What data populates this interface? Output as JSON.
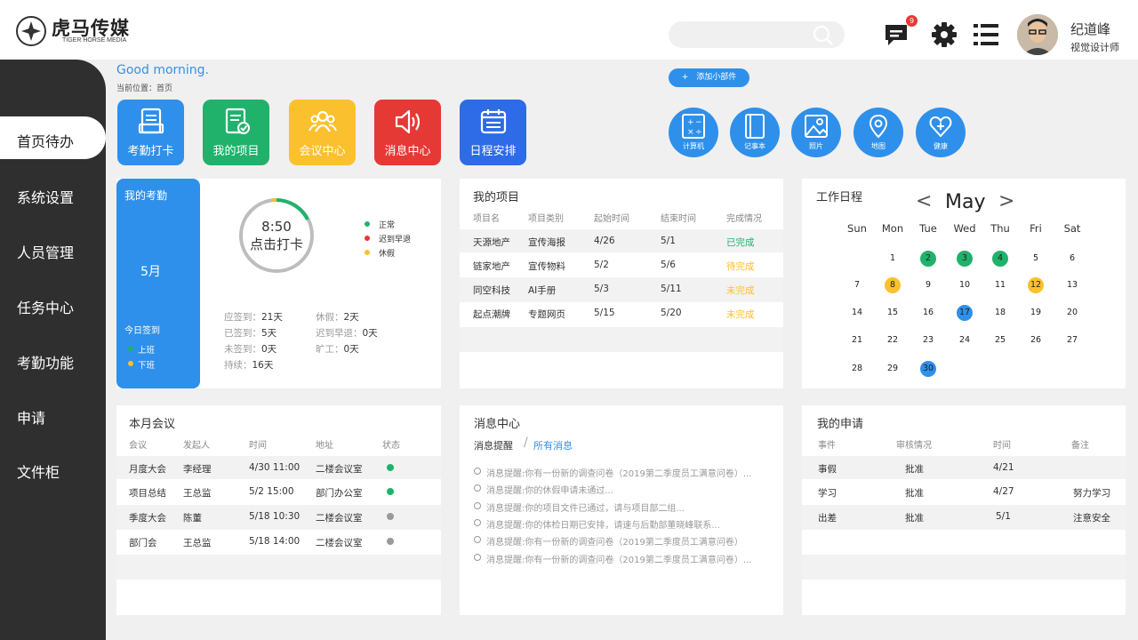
{
  "brand": {
    "name_cn": "虎马传媒",
    "name_en": "TIGER HORSE MEDIA"
  },
  "header": {
    "search_placeholder": "",
    "message_count": "9",
    "user": {
      "name": "纪道峰",
      "role": "视觉设计师"
    }
  },
  "sidebar": {
    "items": [
      "首页待办",
      "系统设置",
      "人员管理",
      "任务中心",
      "考勤功能",
      "申请",
      "文件柜"
    ],
    "active_index": 0
  },
  "greeting": "Good morning.",
  "breadcrumb": "当前位置：首页",
  "add_widget": "+　添加小部件",
  "quick_tiles": [
    {
      "label": "考勤打卡",
      "color": "#2e90ea",
      "icon": "document-icon"
    },
    {
      "label": "我的项目",
      "color": "#20b26b",
      "icon": "checklist-icon"
    },
    {
      "label": "会议中心",
      "color": "#fbc02d",
      "icon": "people-icon"
    },
    {
      "label": "消息中心",
      "color": "#e53935",
      "icon": "speaker-icon"
    },
    {
      "label": "日程安排",
      "color": "#2e6be6",
      "icon": "calendar-icon"
    }
  ],
  "widgets": [
    {
      "label": "计算机",
      "icon": "calculator-icon"
    },
    {
      "label": "记事本",
      "icon": "notebook-icon"
    },
    {
      "label": "照片",
      "icon": "photo-icon"
    },
    {
      "label": "地图",
      "icon": "map-pin-icon"
    },
    {
      "label": "健康",
      "icon": "heart-plus-icon"
    }
  ],
  "attendance": {
    "title": "我的考勤",
    "month": "5月",
    "today_title": "今日签到",
    "shift_on": "上班",
    "shift_off": "下班",
    "clock_time": "8:50",
    "clock_label": "点击打卡",
    "legend": [
      {
        "label": "正常",
        "color": "#20b26b"
      },
      {
        "label": "迟到早退",
        "color": "#e53935"
      },
      {
        "label": "休假",
        "color": "#fbc02d"
      }
    ],
    "stats_left": [
      {
        "label": "应签到：",
        "value": "21天"
      },
      {
        "label": "已签到：",
        "value": "5天"
      },
      {
        "label": "未签到：",
        "value": "0天"
      },
      {
        "label": "持续：",
        "value": "16天"
      }
    ],
    "stats_right": [
      {
        "label": "休假：",
        "value": "2天"
      },
      {
        "label": "迟到早退：",
        "value": "0天"
      },
      {
        "label": "旷工：",
        "value": "0天"
      }
    ]
  },
  "projects": {
    "title": "我的项目",
    "columns": [
      "项目名",
      "项目类别",
      "起始时间",
      "结束时间",
      "完成情况"
    ],
    "rows": [
      {
        "name": "天源地产",
        "type": "宣传海报",
        "start": "4/26",
        "end": "5/1",
        "status": "已完成",
        "status_color": "#20b26b"
      },
      {
        "name": "链家地产",
        "type": "宣传物料",
        "start": "5/2",
        "end": "5/6",
        "status": "待完成",
        "status_color": "#fbc02d"
      },
      {
        "name": "同空科技",
        "type": "AI手册",
        "start": "5/3",
        "end": "5/11",
        "status": "未完成",
        "status_color": "#fbc02d"
      },
      {
        "name": "起点潮牌",
        "type": "专题网页",
        "start": "5/15",
        "end": "5/20",
        "status": "未完成",
        "status_color": "#fbc02d"
      }
    ]
  },
  "schedule": {
    "title": "工作日程",
    "month": "May",
    "weekdays": [
      "Sun",
      "Mon",
      "Tue",
      "Wed",
      "Thu",
      "Fri",
      "Sat"
    ],
    "first_weekday": 1,
    "days_in_month": 30,
    "highlights": {
      "2": "#20b26b",
      "3": "#20b26b",
      "4": "#20b26b",
      "8": "#fbc02d",
      "12": "#fbc02d",
      "17": "#2e90ea",
      "30": "#2e90ea"
    }
  },
  "meetings": {
    "title": "本月会议",
    "columns": [
      "会议",
      "发起人",
      "时间",
      "地址",
      "状态"
    ],
    "rows": [
      {
        "name": "月度大会",
        "host": "李经理",
        "time": "4/30  11:00",
        "place": "二楼会议室",
        "status_color": "#20b26b"
      },
      {
        "name": "项目总结",
        "host": "王总监",
        "time": "5/2  15:00",
        "place": "部门办公室",
        "status_color": "#20b26b"
      },
      {
        "name": "季度大会",
        "host": "陈董",
        "time": "5/18  10:30",
        "place": "二楼会议室",
        "status_color": "#999999"
      },
      {
        "name": "部门会",
        "host": "王总监",
        "time": "5/18  14:00",
        "place": "二楼会议室",
        "status_color": "#999999"
      }
    ]
  },
  "messages": {
    "title": "消息中心",
    "tab_active": "消息提醒",
    "tab_other": "所有消息",
    "items": [
      "消息提醒:你有一份新的调查问卷（2019第二季度员工满意问卷）...",
      "消息提醒:你的休假申请未通过...",
      "消息提醒:你的项目文件已通过，请与项目部二组...",
      "消息提醒:你的体检日期已安排，请速与后勤部董晓峰联系...",
      "消息提醒:你有一份新的调查问卷（2019第二季度员工满意问卷）",
      "消息提醒:你有一份新的调查问卷（2019第二季度员工满意问卷）..."
    ]
  },
  "applications": {
    "title": "我的申请",
    "columns": [
      "事件",
      "审核情况",
      "时间",
      "备注"
    ],
    "rows": [
      {
        "event": "事假",
        "status": "批准",
        "time": "4/21",
        "note": ""
      },
      {
        "event": "学习",
        "status": "批准",
        "time": "4/27",
        "note": "努力学习"
      },
      {
        "event": "出差",
        "status": "批准",
        "time": "5/1",
        "note": "注意安全"
      }
    ]
  }
}
